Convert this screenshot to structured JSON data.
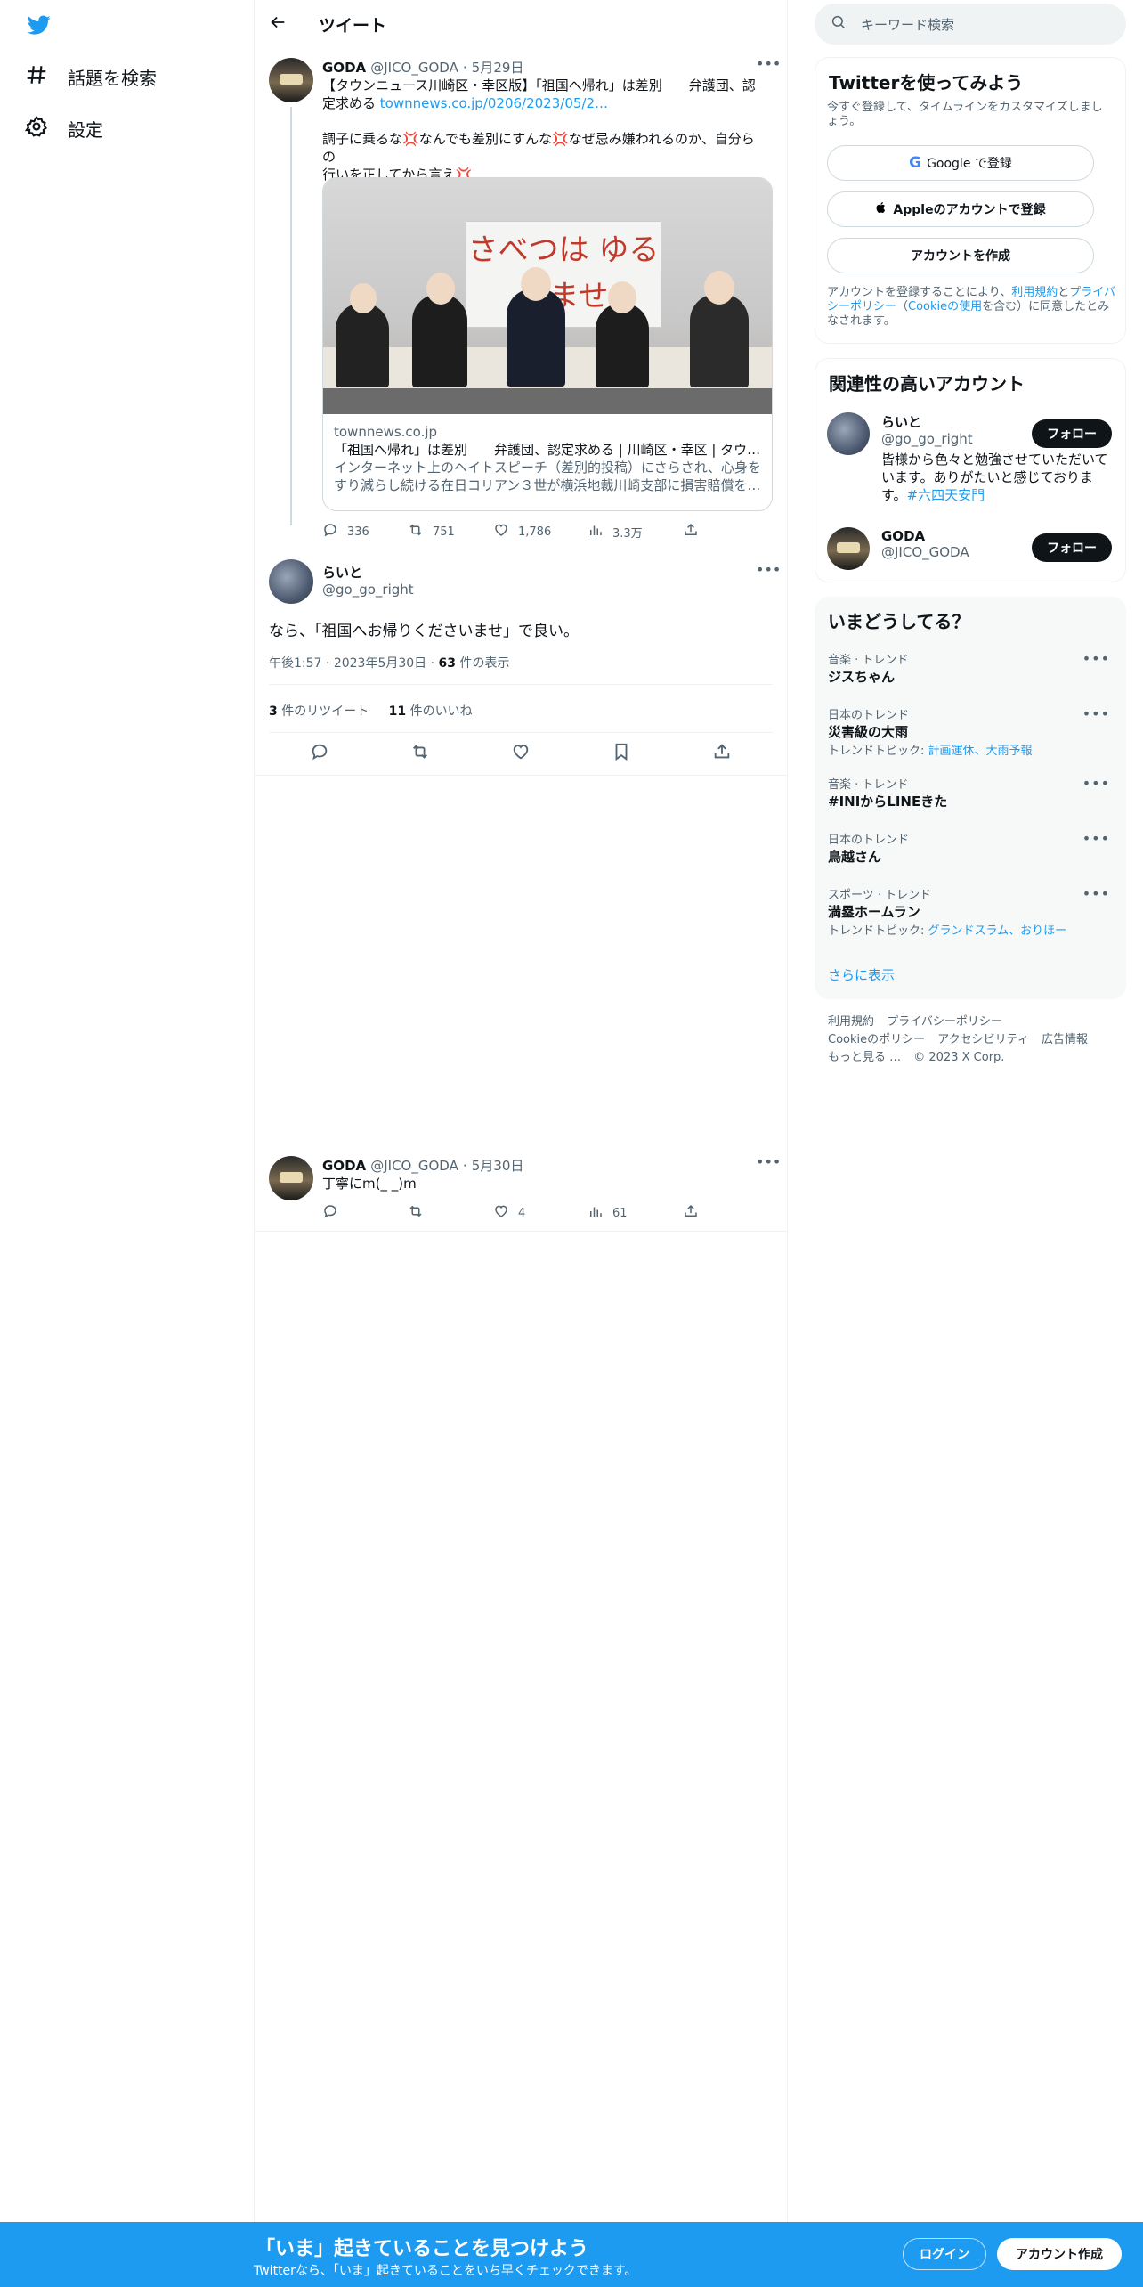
{
  "nav": {
    "items": [
      {
        "label": "話題を検索",
        "icon": "hashtag-icon"
      },
      {
        "label": "設定",
        "icon": "gear-icon"
      }
    ]
  },
  "header": {
    "title": "ツイート"
  },
  "tweets": {
    "parent": {
      "name": "GODA",
      "handle": "@JICO_GODA",
      "sep": "·",
      "date": "5月29日",
      "text_line1": "【タウンニュース川崎区・幸区版】「祖国へ帰れ」は差別　　弁護団、認",
      "text_line2_pre": "定求める ",
      "link": "townnews.co.jp/0206/2023/05/2…",
      "para2_a": "調子に乗るな",
      "para2_b": "なんでも差別にすんな",
      "para2_c": "なぜ忌み嫌われるのか、自分らの",
      "para2_d": "行いを正してから言え",
      "card": {
        "banner": "さべつは ゆるしませ",
        "domain": "townnews.co.jp",
        "title": "「祖国へ帰れ」は差別　　弁護団、認定求める | 川崎区・幸区 | タウ…",
        "desc_line1": "インターネット上のヘイトスピーチ（差別的投稿）にさらされ、心身を",
        "desc_line2": "すり減らし続ける在日コリアン３世が横浜地裁川崎支部に損害賠償を…"
      },
      "replies": "336",
      "retweets": "751",
      "likes": "1,786",
      "views": "3.3万"
    },
    "main": {
      "name": "らいと",
      "handle": "@go_go_right",
      "text": "なら、「祖国へお帰りくださいませ」で良い。",
      "time": "午後1:57",
      "date": "2023年5月30日",
      "views_count": "63",
      "views_label": "件の表示",
      "retweets_count": "3",
      "retweets_label": "件のリツイート",
      "likes_count": "11",
      "likes_label": "件のいいね"
    },
    "reply": {
      "name": "GODA",
      "handle": "@JICO_GODA",
      "sep": "·",
      "date": "5月30日",
      "text": "丁寧にm(_ _)m",
      "likes": "4",
      "views": "61"
    }
  },
  "sidebar": {
    "search_placeholder": "キーワード検索",
    "signup": {
      "title": "Twitterを使ってみよう",
      "subtitle": "今すぐ登録して、タイムラインをカスタマイズしましょう。",
      "google": "Google で登録",
      "apple": "Appleのアカウントで登録",
      "create": "アカウントを作成",
      "terms_pre": "アカウントを登録することにより、",
      "terms_link1": "利用規約",
      "terms_and": "と",
      "terms_link2": "プライバシーポリシー",
      "terms_paren_open": "（",
      "terms_link3": "Cookieの使用",
      "terms_post": "を含む）に同意したとみなされます。"
    },
    "related": {
      "title": "関連性の高いアカウント",
      "accounts": [
        {
          "name": "らいと",
          "handle": "@go_go_right",
          "bio": "皆様から色々と勉強させていただいています。ありがたいと感じております。",
          "bio_tag": "#六四天安門",
          "follow": "フォロー"
        },
        {
          "name": "GODA",
          "handle": "@JICO_GODA",
          "follow": "フォロー"
        }
      ]
    },
    "trends": {
      "title": "いまどうしてる？",
      "items": [
        {
          "category": "音楽 · トレンド",
          "name": "ジスちゃん"
        },
        {
          "category": "日本のトレンド",
          "name": "災害級の大雨",
          "sub_pre": "トレンドトピック: ",
          "sub_links": "計画運休、大雨予報"
        },
        {
          "category": "音楽 · トレンド",
          "name": "#INIからLINEきた"
        },
        {
          "category": "日本のトレンド",
          "name": "鳥越さん"
        },
        {
          "category": "スポーツ · トレンド",
          "name": "満塁ホームラン",
          "sub_pre": "トレンドトピック: ",
          "sub_links": "グランドスラム、おりほー"
        }
      ],
      "show_more": "さらに表示"
    },
    "footer": {
      "row1": [
        "利用規約",
        "プライバシーポリシー"
      ],
      "row2": [
        "Cookieのポリシー",
        "アクセシビリティ",
        "広告情報"
      ],
      "more": "もっと見る …",
      "copyright": "© 2023 X Corp."
    }
  },
  "bottom_bar": {
    "title": "「いま」起きていることを見つけよう",
    "subtitle": "Twitterなら、「いま」起きていることをいち早くチェックできます。",
    "login": "ログイン",
    "signup": "アカウント作成"
  },
  "colors": {
    "accent": "#1d9bf0",
    "text": "#0f1419",
    "muted": "#536471",
    "border": "#eff3f4"
  }
}
